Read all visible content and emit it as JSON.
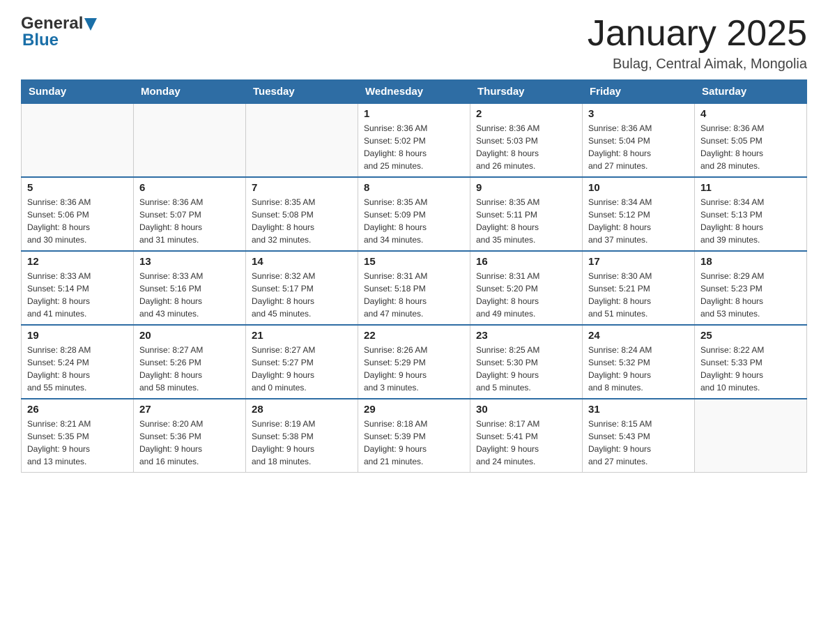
{
  "header": {
    "logo_general": "General",
    "logo_blue": "Blue",
    "month_title": "January 2025",
    "location": "Bulag, Central Aimak, Mongolia"
  },
  "weekdays": [
    "Sunday",
    "Monday",
    "Tuesday",
    "Wednesday",
    "Thursday",
    "Friday",
    "Saturday"
  ],
  "weeks": [
    [
      {
        "day": "",
        "info": ""
      },
      {
        "day": "",
        "info": ""
      },
      {
        "day": "",
        "info": ""
      },
      {
        "day": "1",
        "info": "Sunrise: 8:36 AM\nSunset: 5:02 PM\nDaylight: 8 hours\nand 25 minutes."
      },
      {
        "day": "2",
        "info": "Sunrise: 8:36 AM\nSunset: 5:03 PM\nDaylight: 8 hours\nand 26 minutes."
      },
      {
        "day": "3",
        "info": "Sunrise: 8:36 AM\nSunset: 5:04 PM\nDaylight: 8 hours\nand 27 minutes."
      },
      {
        "day": "4",
        "info": "Sunrise: 8:36 AM\nSunset: 5:05 PM\nDaylight: 8 hours\nand 28 minutes."
      }
    ],
    [
      {
        "day": "5",
        "info": "Sunrise: 8:36 AM\nSunset: 5:06 PM\nDaylight: 8 hours\nand 30 minutes."
      },
      {
        "day": "6",
        "info": "Sunrise: 8:36 AM\nSunset: 5:07 PM\nDaylight: 8 hours\nand 31 minutes."
      },
      {
        "day": "7",
        "info": "Sunrise: 8:35 AM\nSunset: 5:08 PM\nDaylight: 8 hours\nand 32 minutes."
      },
      {
        "day": "8",
        "info": "Sunrise: 8:35 AM\nSunset: 5:09 PM\nDaylight: 8 hours\nand 34 minutes."
      },
      {
        "day": "9",
        "info": "Sunrise: 8:35 AM\nSunset: 5:11 PM\nDaylight: 8 hours\nand 35 minutes."
      },
      {
        "day": "10",
        "info": "Sunrise: 8:34 AM\nSunset: 5:12 PM\nDaylight: 8 hours\nand 37 minutes."
      },
      {
        "day": "11",
        "info": "Sunrise: 8:34 AM\nSunset: 5:13 PM\nDaylight: 8 hours\nand 39 minutes."
      }
    ],
    [
      {
        "day": "12",
        "info": "Sunrise: 8:33 AM\nSunset: 5:14 PM\nDaylight: 8 hours\nand 41 minutes."
      },
      {
        "day": "13",
        "info": "Sunrise: 8:33 AM\nSunset: 5:16 PM\nDaylight: 8 hours\nand 43 minutes."
      },
      {
        "day": "14",
        "info": "Sunrise: 8:32 AM\nSunset: 5:17 PM\nDaylight: 8 hours\nand 45 minutes."
      },
      {
        "day": "15",
        "info": "Sunrise: 8:31 AM\nSunset: 5:18 PM\nDaylight: 8 hours\nand 47 minutes."
      },
      {
        "day": "16",
        "info": "Sunrise: 8:31 AM\nSunset: 5:20 PM\nDaylight: 8 hours\nand 49 minutes."
      },
      {
        "day": "17",
        "info": "Sunrise: 8:30 AM\nSunset: 5:21 PM\nDaylight: 8 hours\nand 51 minutes."
      },
      {
        "day": "18",
        "info": "Sunrise: 8:29 AM\nSunset: 5:23 PM\nDaylight: 8 hours\nand 53 minutes."
      }
    ],
    [
      {
        "day": "19",
        "info": "Sunrise: 8:28 AM\nSunset: 5:24 PM\nDaylight: 8 hours\nand 55 minutes."
      },
      {
        "day": "20",
        "info": "Sunrise: 8:27 AM\nSunset: 5:26 PM\nDaylight: 8 hours\nand 58 minutes."
      },
      {
        "day": "21",
        "info": "Sunrise: 8:27 AM\nSunset: 5:27 PM\nDaylight: 9 hours\nand 0 minutes."
      },
      {
        "day": "22",
        "info": "Sunrise: 8:26 AM\nSunset: 5:29 PM\nDaylight: 9 hours\nand 3 minutes."
      },
      {
        "day": "23",
        "info": "Sunrise: 8:25 AM\nSunset: 5:30 PM\nDaylight: 9 hours\nand 5 minutes."
      },
      {
        "day": "24",
        "info": "Sunrise: 8:24 AM\nSunset: 5:32 PM\nDaylight: 9 hours\nand 8 minutes."
      },
      {
        "day": "25",
        "info": "Sunrise: 8:22 AM\nSunset: 5:33 PM\nDaylight: 9 hours\nand 10 minutes."
      }
    ],
    [
      {
        "day": "26",
        "info": "Sunrise: 8:21 AM\nSunset: 5:35 PM\nDaylight: 9 hours\nand 13 minutes."
      },
      {
        "day": "27",
        "info": "Sunrise: 8:20 AM\nSunset: 5:36 PM\nDaylight: 9 hours\nand 16 minutes."
      },
      {
        "day": "28",
        "info": "Sunrise: 8:19 AM\nSunset: 5:38 PM\nDaylight: 9 hours\nand 18 minutes."
      },
      {
        "day": "29",
        "info": "Sunrise: 8:18 AM\nSunset: 5:39 PM\nDaylight: 9 hours\nand 21 minutes."
      },
      {
        "day": "30",
        "info": "Sunrise: 8:17 AM\nSunset: 5:41 PM\nDaylight: 9 hours\nand 24 minutes."
      },
      {
        "day": "31",
        "info": "Sunrise: 8:15 AM\nSunset: 5:43 PM\nDaylight: 9 hours\nand 27 minutes."
      },
      {
        "day": "",
        "info": ""
      }
    ]
  ]
}
